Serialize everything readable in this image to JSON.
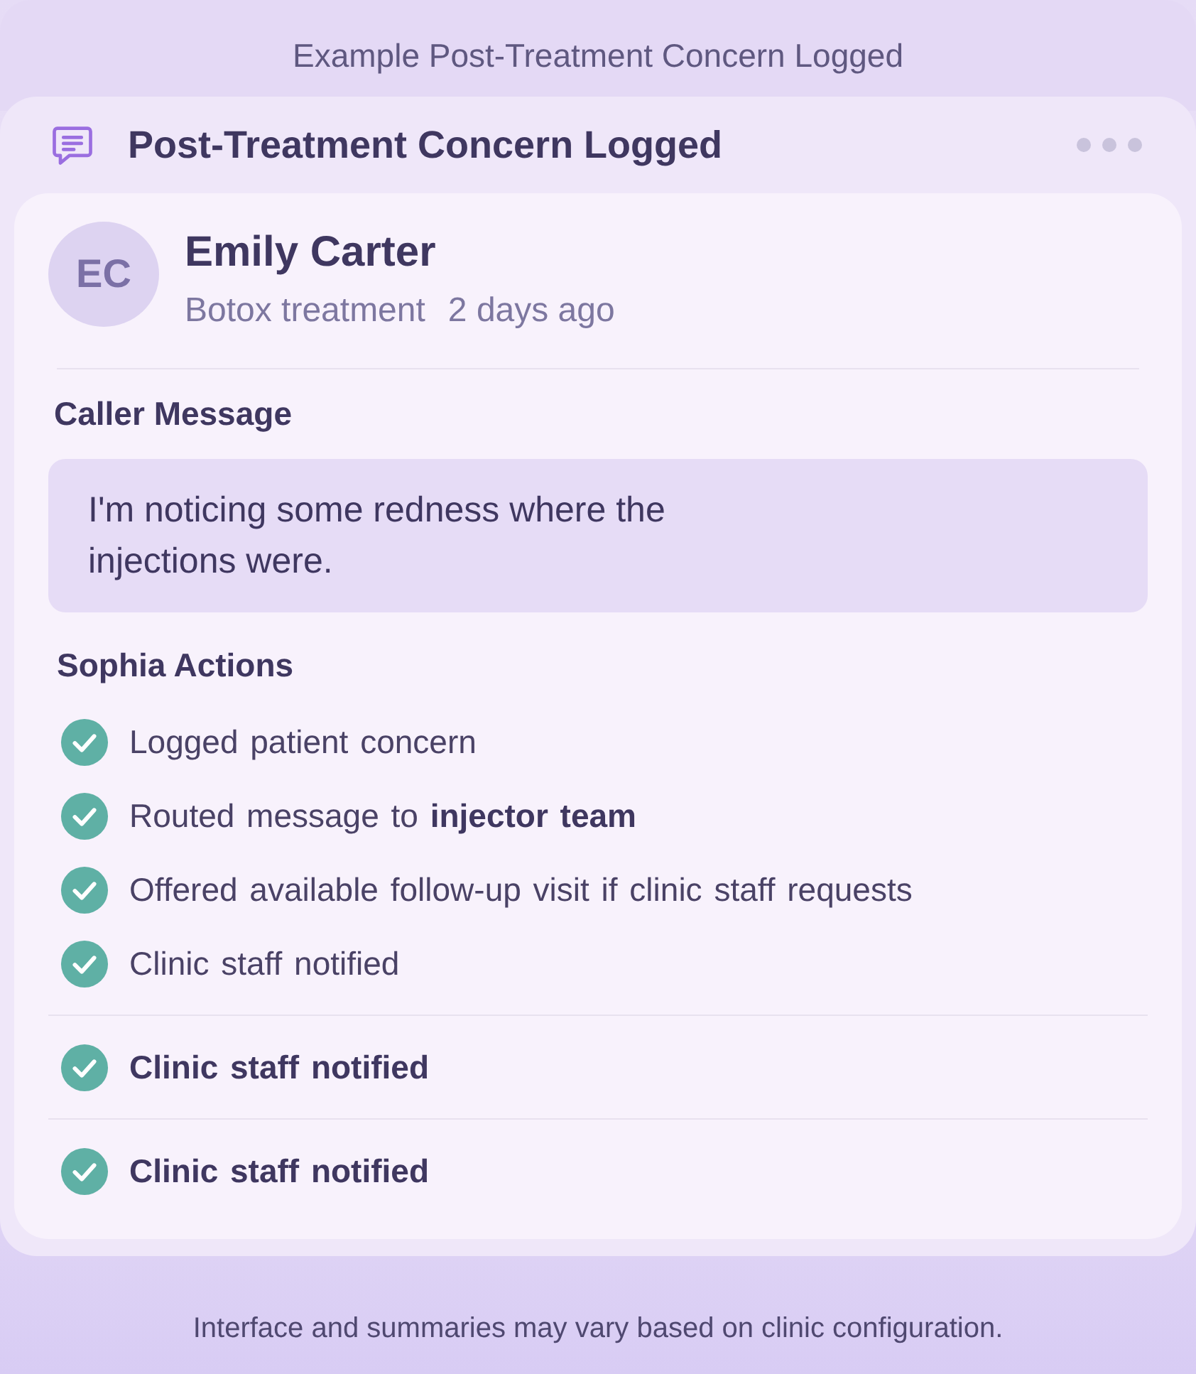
{
  "banner": {
    "title": "Example Post-Treatment Concern Logged"
  },
  "panel": {
    "title": "Post-Treatment Concern Logged"
  },
  "patient": {
    "initials": "EC",
    "name": "Emily Carter",
    "treatment": "Botox treatment",
    "time": "2 days ago"
  },
  "message": {
    "heading": "Caller Message",
    "text": "I'm noticing some redness where the injections were."
  },
  "actions": {
    "heading": "Sophia Actions",
    "items": [
      {
        "text": "Logged patient concern",
        "done": true,
        "separated": false
      },
      {
        "text": "Routed message to **injector team**",
        "done": true,
        "separated": false
      },
      {
        "text": "Offered available follow-up visit if clinic staff requests",
        "done": true,
        "separated": false
      },
      {
        "text": "Clinic staff notified",
        "done": true,
        "separated": false
      },
      {
        "text": "**Clinic staff notified**",
        "done": true,
        "separated": true
      },
      {
        "text": "**Clinic staff notified**",
        "done": true,
        "separated": true
      }
    ]
  },
  "footer": {
    "note": "Interface and summaries may vary based on clinic configuration."
  }
}
